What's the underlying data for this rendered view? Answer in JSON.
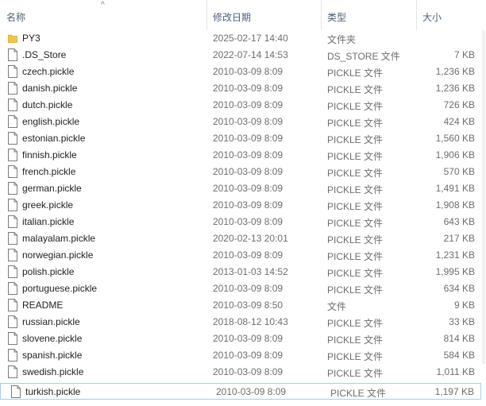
{
  "columns": {
    "name": "名称",
    "date": "修改日期",
    "type": "类型",
    "size": "大小"
  },
  "files": [
    {
      "name": "PY3",
      "date": "2025-02-17 14:40",
      "type": "文件夹",
      "size": "",
      "kind": "folder"
    },
    {
      "name": ".DS_Store",
      "date": "2022-07-14 14:53",
      "type": "DS_STORE 文件",
      "size": "7 KB",
      "kind": "file"
    },
    {
      "name": "czech.pickle",
      "date": "2010-03-09 8:09",
      "type": "PICKLE 文件",
      "size": "1,236 KB",
      "kind": "file"
    },
    {
      "name": "danish.pickle",
      "date": "2010-03-09 8:09",
      "type": "PICKLE 文件",
      "size": "1,236 KB",
      "kind": "file"
    },
    {
      "name": "dutch.pickle",
      "date": "2010-03-09 8:09",
      "type": "PICKLE 文件",
      "size": "726 KB",
      "kind": "file"
    },
    {
      "name": "english.pickle",
      "date": "2010-03-09 8:09",
      "type": "PICKLE 文件",
      "size": "424 KB",
      "kind": "file"
    },
    {
      "name": "estonian.pickle",
      "date": "2010-03-09 8:09",
      "type": "PICKLE 文件",
      "size": "1,560 KB",
      "kind": "file"
    },
    {
      "name": "finnish.pickle",
      "date": "2010-03-09 8:09",
      "type": "PICKLE 文件",
      "size": "1,906 KB",
      "kind": "file"
    },
    {
      "name": "french.pickle",
      "date": "2010-03-09 8:09",
      "type": "PICKLE 文件",
      "size": "570 KB",
      "kind": "file"
    },
    {
      "name": "german.pickle",
      "date": "2010-03-09 8:09",
      "type": "PICKLE 文件",
      "size": "1,491 KB",
      "kind": "file"
    },
    {
      "name": "greek.pickle",
      "date": "2010-03-09 8:09",
      "type": "PICKLE 文件",
      "size": "1,908 KB",
      "kind": "file"
    },
    {
      "name": "italian.pickle",
      "date": "2010-03-09 8:09",
      "type": "PICKLE 文件",
      "size": "643 KB",
      "kind": "file"
    },
    {
      "name": "malayalam.pickle",
      "date": "2020-02-13 20:01",
      "type": "PICKLE 文件",
      "size": "217 KB",
      "kind": "file"
    },
    {
      "name": "norwegian.pickle",
      "date": "2010-03-09 8:09",
      "type": "PICKLE 文件",
      "size": "1,231 KB",
      "kind": "file"
    },
    {
      "name": "polish.pickle",
      "date": "2013-01-03 14:52",
      "type": "PICKLE 文件",
      "size": "1,995 KB",
      "kind": "file"
    },
    {
      "name": "portuguese.pickle",
      "date": "2010-03-09 8:09",
      "type": "PICKLE 文件",
      "size": "634 KB",
      "kind": "file"
    },
    {
      "name": "README",
      "date": "2010-03-09 8:50",
      "type": "文件",
      "size": "9 KB",
      "kind": "file"
    },
    {
      "name": "russian.pickle",
      "date": "2018-08-12 10:43",
      "type": "PICKLE 文件",
      "size": "33 KB",
      "kind": "file"
    },
    {
      "name": "slovene.pickle",
      "date": "2010-03-09 8:09",
      "type": "PICKLE 文件",
      "size": "814 KB",
      "kind": "file"
    },
    {
      "name": "spanish.pickle",
      "date": "2010-03-09 8:09",
      "type": "PICKLE 文件",
      "size": "584 KB",
      "kind": "file"
    },
    {
      "name": "swedish.pickle",
      "date": "2010-03-09 8:09",
      "type": "PICKLE 文件",
      "size": "1,011 KB",
      "kind": "file"
    },
    {
      "name": "turkish.pickle",
      "date": "2010-03-09 8:09",
      "type": "PICKLE 文件",
      "size": "1,197 KB",
      "kind": "file",
      "selected": true
    }
  ],
  "colors": {
    "header_text": "#4c607a",
    "row_text": "#1e1e1e",
    "meta_text": "#6d6d6d",
    "selection_border": "#99d1ff",
    "folder": "#f3c443"
  }
}
